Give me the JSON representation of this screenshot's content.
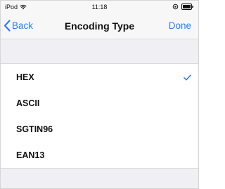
{
  "status_bar": {
    "carrier": "iPod",
    "time": "11:18"
  },
  "nav": {
    "back_label": "Back",
    "title": "Encoding Type",
    "done_label": "Done"
  },
  "options": [
    {
      "label": "HEX",
      "selected": true
    },
    {
      "label": "ASCII",
      "selected": false
    },
    {
      "label": "SGTIN96",
      "selected": false
    },
    {
      "label": "EAN13",
      "selected": false
    }
  ],
  "colors": {
    "accent": "#2f7cf6",
    "background": "#efeff4"
  },
  "icons": {
    "back": "chevron-left-icon",
    "check": "checkmark-icon",
    "wifi": "wifi-icon",
    "battery": "battery-icon"
  }
}
